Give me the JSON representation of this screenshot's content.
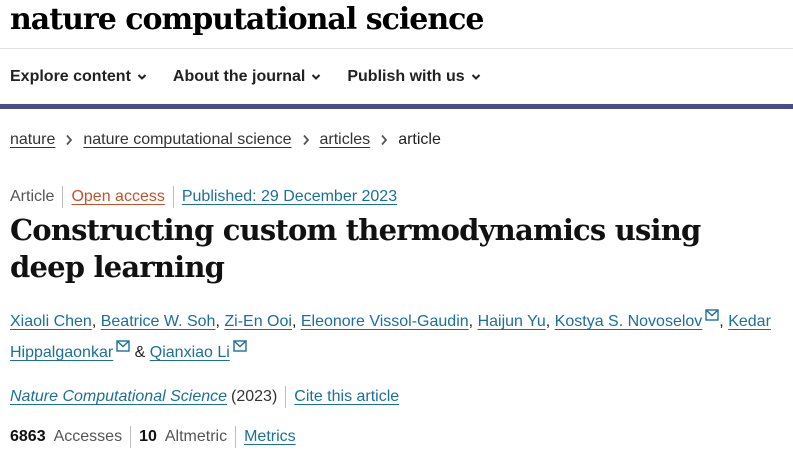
{
  "header": {
    "journal_name": "nature computational science"
  },
  "nav": {
    "items": [
      {
        "label": "Explore content"
      },
      {
        "label": "About the journal"
      },
      {
        "label": "Publish with us"
      }
    ]
  },
  "breadcrumb": {
    "items": [
      "nature",
      "nature computational science",
      "articles"
    ],
    "current": "article"
  },
  "article": {
    "type": "Article",
    "access": "Open access",
    "published": "Published: 29 December 2023",
    "title": "Constructing custom thermodynamics using deep learning",
    "authors": [
      "Xiaoli Chen",
      "Beatrice W. Soh",
      "Zi-En Ooi",
      "Eleonore Vissol-Gaudin",
      "Haijun Yu",
      "Kostya S. Novoselov",
      "Kedar Hippalgaonkar",
      "Qianxiao Li"
    ],
    "author_separator": ",",
    "author_and": "&",
    "journal": "Nature Computational Science",
    "year": "(2023)",
    "cite_label": "Cite this article"
  },
  "metrics": {
    "accesses_count": "6863",
    "accesses_label": "Accesses",
    "altmetric_count": "10",
    "altmetric_label": "Altmetric",
    "metrics_link": "Metrics"
  },
  "colors": {
    "accent_bar": "#4b4a8b",
    "link": "#1b6f9a",
    "open_access": "#c0532b"
  },
  "icons": {
    "nav_chevron": "chevron-down-icon",
    "breadcrumb_separator": "chevron-right-icon",
    "author_contact": "mail-icon"
  }
}
